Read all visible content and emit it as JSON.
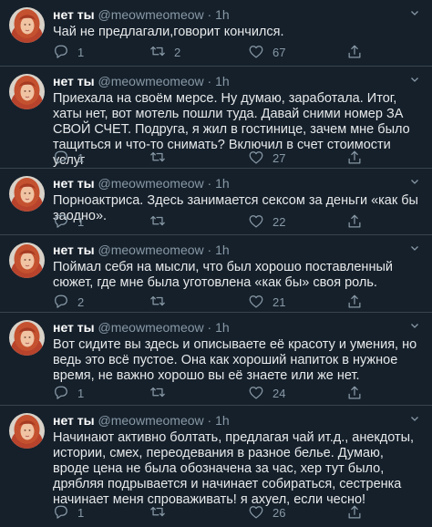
{
  "colors": {
    "background": "#15202b",
    "text": "#e7e9ea",
    "secondary": "#8899a6",
    "divider": "#38444d"
  },
  "icons": [
    "reply-icon",
    "retweet-icon",
    "like-icon",
    "share-icon",
    "chevron-down-icon"
  ],
  "tweets": [
    {
      "name": "нет ты",
      "handle": "@meowmeomeow",
      "time": "· 1h",
      "text": "Чай не предлагали,говорит кончился.",
      "replies": "1",
      "retweets": "2",
      "likes": "67"
    },
    {
      "name": "нет ты",
      "handle": "@meowmeomeow",
      "time": "· 1h",
      "text": "Приехала на своём мерсе. Ну думаю, заработала. Итог, хаты нет, вот мотель пошли туда. Давай сними номер ЗА СВОЙ СЧЕТ. Подруга, я жил в гостинице, зачем мне было тащиться и что-то снимать? Включил в счет стоимости услуг",
      "replies": "1",
      "retweets": "",
      "likes": "27"
    },
    {
      "name": "нет ты",
      "handle": "@meowmeomeow",
      "time": "· 1h",
      "text": "Порноактриса. Здесь занимается сексом за деньги «как бы заодно».",
      "replies": "1",
      "retweets": "",
      "likes": "22"
    },
    {
      "name": "нет ты",
      "handle": "@meowmeomeow",
      "time": "· 1h",
      "text": "Поймал себя на мысли, что был хорошо поставленный сюжет, где мне была уготовлена «как бы» своя роль.",
      "replies": "2",
      "retweets": "",
      "likes": "21"
    },
    {
      "name": "нет ты",
      "handle": "@meowmeomeow",
      "time": "· 1h",
      "text": "Вот сидите вы здесь и описываете её красоту и умения, но ведь это всё пустое. Она как хороший напиток в нужное время, не важно хорошо вы её знаете или же нет.",
      "replies": "1",
      "retweets": "",
      "likes": "24"
    },
    {
      "name": "нет ты",
      "handle": "@meowmeomeow",
      "time": "· 1h",
      "text": "Начинают активно болтать, предлагая чай ит.д., анекдоты, истории, смех, переодевания в разное белье. Думаю, вроде цена не была обозначена за час, хер тут было, дрябляя подрывается и начинает собираться, сестренка начинает меня спроваживать! я ахуел, если чесно!",
      "replies": "1",
      "retweets": "",
      "likes": "26"
    }
  ]
}
